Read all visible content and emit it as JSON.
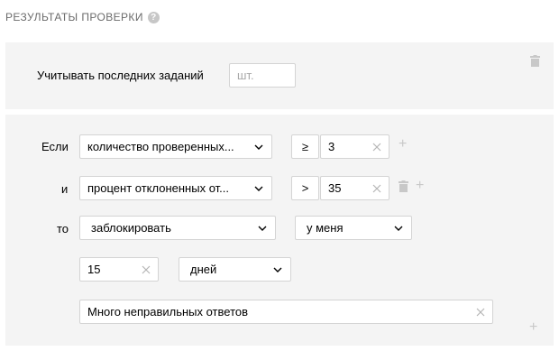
{
  "section": {
    "title": "РЕЗУЛЬТАТЫ ПРОВЕРКИ",
    "help_glyph": "?"
  },
  "top_rule": {
    "label": "Учитывать последних заданий",
    "input_placeholder": "шт."
  },
  "conditions": {
    "if_label": "Если",
    "and_label": "и",
    "then_label": "то",
    "row1": {
      "field": "количество проверенных...",
      "operator": "≥",
      "value": "3"
    },
    "row2": {
      "field": "процент отклоненных от...",
      "operator": ">",
      "value": "35"
    },
    "action": {
      "value": "заблокировать",
      "scope": "у меня"
    },
    "duration": {
      "value": "15",
      "unit": "дней"
    },
    "reason": {
      "value": "Много неправильных ответов"
    }
  },
  "icons": {
    "help": "question-circle-icon",
    "trash": "trash-icon",
    "plus": "plus-icon",
    "chevron": "chevron-down-icon",
    "clear": "close-icon"
  },
  "colors": {
    "panel": "#f4f4f4",
    "border": "#d4d4d4",
    "muted_icon": "#c8c8c8"
  }
}
